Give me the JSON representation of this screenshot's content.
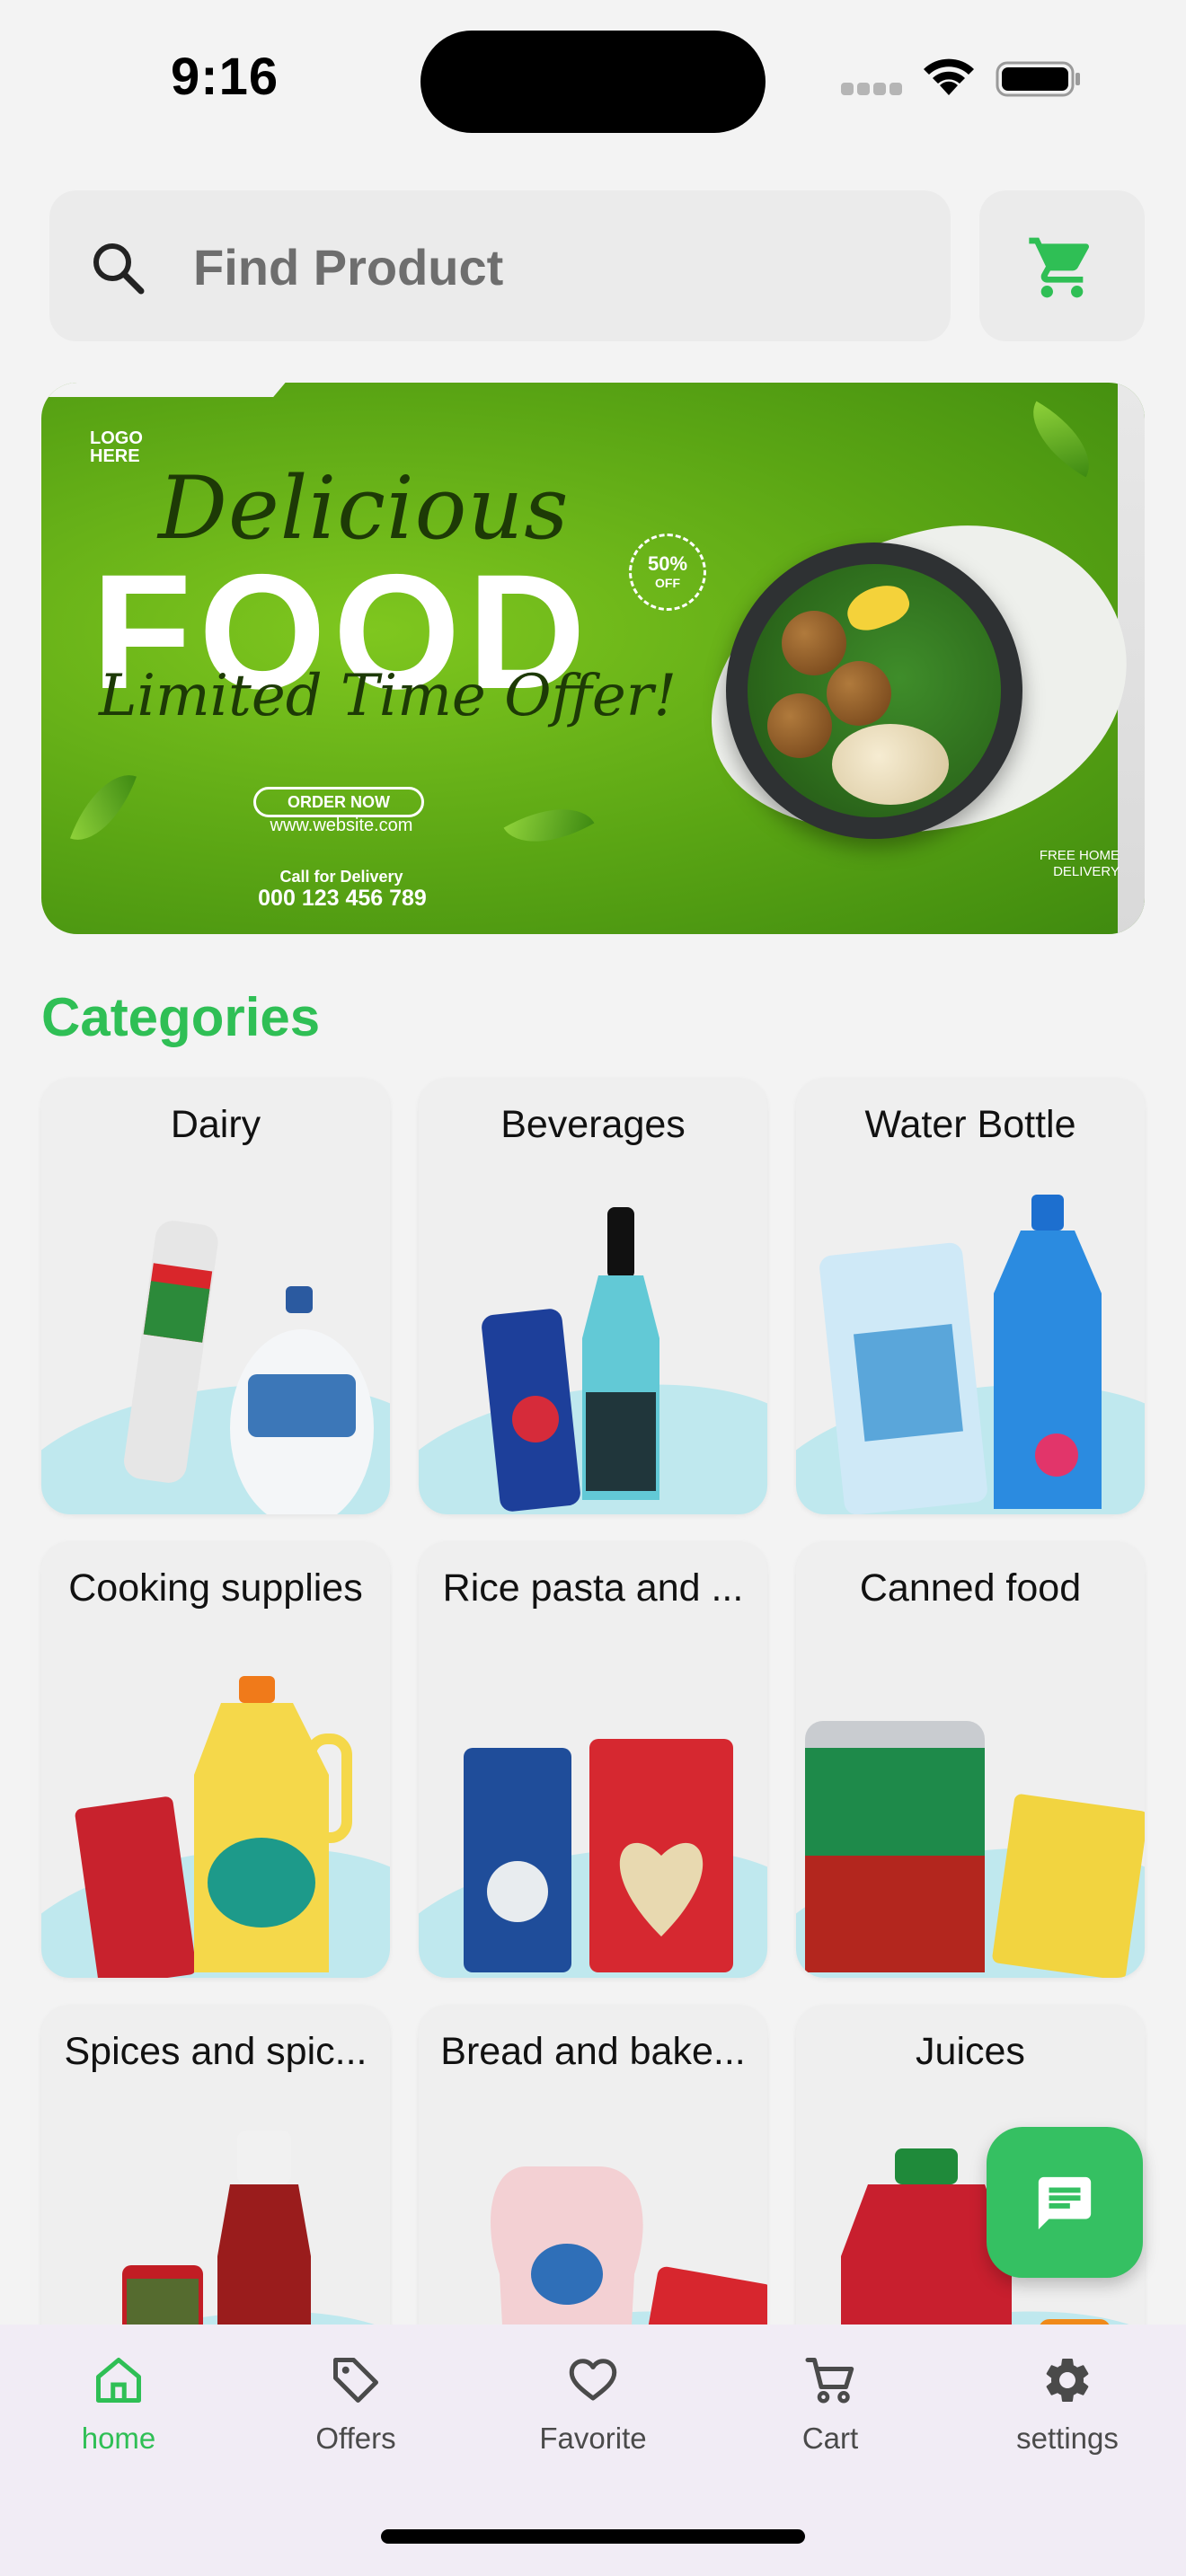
{
  "status_bar": {
    "time": "9:16"
  },
  "search": {
    "placeholder": "Find Product",
    "value": ""
  },
  "banner": {
    "logo": "LOGO HERE",
    "headline_1": "Delicious",
    "headline_2": "FOOD",
    "headline_3": "Limited Time Offer!",
    "badge_percent": "50%",
    "badge_off": "OFF",
    "order_button": "ORDER NOW",
    "website": "www.website.com",
    "call_label": "Call for Delivery",
    "phone": "000 123 456 789",
    "delivery": "FREE HOME DELIVERY"
  },
  "categories": {
    "title": "Categories",
    "items": [
      {
        "label": "Dairy"
      },
      {
        "label": "Beverages"
      },
      {
        "label": "Water Bottle"
      },
      {
        "label": "Cooking supplies"
      },
      {
        "label": "Rice pasta and ..."
      },
      {
        "label": "Canned food"
      },
      {
        "label": "Spices and spic..."
      },
      {
        "label": "Bread and bake..."
      },
      {
        "label": "Juices"
      }
    ]
  },
  "bottom_nav": {
    "items": [
      {
        "label": "home",
        "icon": "home-icon",
        "active": true
      },
      {
        "label": "Offers",
        "icon": "tag-icon",
        "active": false
      },
      {
        "label": "Favorite",
        "icon": "heart-icon",
        "active": false
      },
      {
        "label": "Cart",
        "icon": "cart-icon",
        "active": false
      },
      {
        "label": "settings",
        "icon": "gear-icon",
        "active": false
      }
    ]
  },
  "colors": {
    "accent": "#2fbf55",
    "fab": "#35c062",
    "nav_background": "#f1ecf5",
    "search_background": "#ebebeb"
  }
}
